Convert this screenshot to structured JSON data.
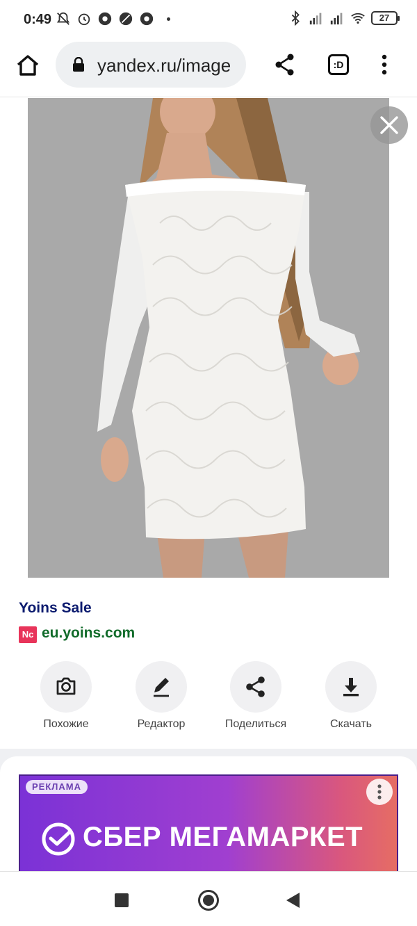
{
  "status_bar": {
    "time": "0:49",
    "battery": "27",
    "icons_left": [
      "notifications-off-icon",
      "alarm-icon",
      "chrome-icon",
      "app-icon",
      "chrome-icon"
    ],
    "icons_right": [
      "bluetooth-icon",
      "signal-icon",
      "signal-icon",
      "wifi-icon",
      "battery-icon"
    ]
  },
  "browser": {
    "url": "yandex.ru/image",
    "tabs_label": ":D"
  },
  "result": {
    "title": "Yoins Sale",
    "favicon_text": "Nc",
    "domain": "eu.yoins.com"
  },
  "actions": [
    {
      "label": "Похожие",
      "icon": "camera-search-icon"
    },
    {
      "label": "Редактор",
      "icon": "pencil-icon"
    },
    {
      "label": "Поделиться",
      "icon": "share-icon"
    },
    {
      "label": "Скачать",
      "icon": "download-icon"
    }
  ],
  "ad": {
    "tag": "РЕКЛАМА",
    "brand": "СБЕР МЕГАМАРКЕТ"
  },
  "colors": {
    "title": "#0b1a6e",
    "domain": "#116b2a",
    "photo_bg": "#a9a9a9",
    "ad_gradient_start": "#7b32d6",
    "ad_gradient_end": "#e66d64"
  }
}
